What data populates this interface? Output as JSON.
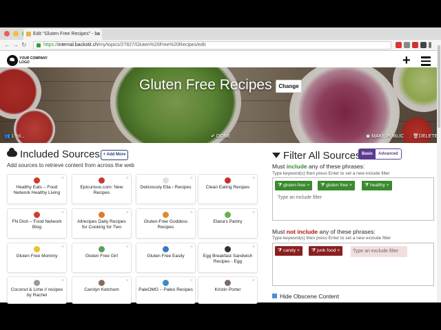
{
  "browser": {
    "tab_title": "Edit \"Gluten Free Recipes\" - ba",
    "url_scheme": "https://",
    "url_host": "internal.backstit.ch",
    "url_path": "/my/topics/27827/Gluten%20Free%20Recipes/edit"
  },
  "header": {
    "logo_line1": "YOUR COMPANY",
    "logo_line2": "LOGO"
  },
  "hero": {
    "title": "Gluten Free Recipes",
    "change_label": "Change",
    "follower_text": "1 fol...",
    "done_label": "DONE",
    "make_public_label": "MAKE PUBLIC",
    "delete_label": "DELETE"
  },
  "sources": {
    "heading": "Included Sources",
    "add_more_label": "+ Add More",
    "subtitle": "Add sources to retrieve content from across the web",
    "cards": [
      {
        "label": "Healthy Eats – Food Network Healthy Living",
        "icon_color": "#d23b2a"
      },
      {
        "label": "Epicurious.com: New Recipes",
        "icon_color": "#c43a3a"
      },
      {
        "label": "Deliciously Ella › Recipes",
        "icon_color": "#e0e0e0"
      },
      {
        "label": "Clean Eating Recipes",
        "icon_color": "#c4302b"
      },
      {
        "label": "FN Dish – Food Network Blog",
        "icon_color": "#d23b2a"
      },
      {
        "label": "Allrecipes Daily Recipes for Cooking for Two",
        "icon_color": "#e07a2c"
      },
      {
        "label": "Gluten-Free Goddess Recipes",
        "icon_color": "#e58a2c"
      },
      {
        "label": "Elana's Pantry",
        "icon_color": "#6ab04c"
      },
      {
        "label": "Gluten Free Mommy",
        "icon_color": "#e8c32e"
      },
      {
        "label": "Gluten Free Girl",
        "icon_color": "#5aa05a"
      },
      {
        "label": "Gluten Free Easily",
        "icon_color": "#3a7ac0"
      },
      {
        "label": "Egg Breakfast Sandwich Recipes - Egg",
        "icon_color": "#333333"
      },
      {
        "label": "Coconut & Lime // recipes by Rachel",
        "icon_color": "#9a9a9a"
      },
      {
        "label": "Carolyn Ketchum",
        "icon_color": "#8a6a5a"
      },
      {
        "label": "PaleOMG – Paleo Recipes",
        "icon_color": "#3a8ad0"
      },
      {
        "label": "Kristin Porter",
        "icon_color": "#7a6a6a"
      }
    ]
  },
  "filters": {
    "heading": "Filter All Sources",
    "mode_basic": "Basic",
    "mode_advanced": "Advanced",
    "include_prefix": "Must ",
    "include_word": "include",
    "include_suffix": " any of these phrases:",
    "include_hint": "Type keyword(s) then press Enter to set a new include filter",
    "include_chips": [
      "gluten-free",
      "gluten free",
      "healthy"
    ],
    "include_placeholder": "Type an include filter",
    "exclude_prefix": "Must ",
    "exclude_word": "not include",
    "exclude_suffix": " any of these phrases:",
    "exclude_hint": "Type keyword(s) then press Enter to set a new exclude filter",
    "exclude_chips": [
      "candy",
      "junk food"
    ],
    "exclude_placeholder": "Type an exclude filter",
    "hide_obscene_label": "Hide Obscene Content"
  }
}
